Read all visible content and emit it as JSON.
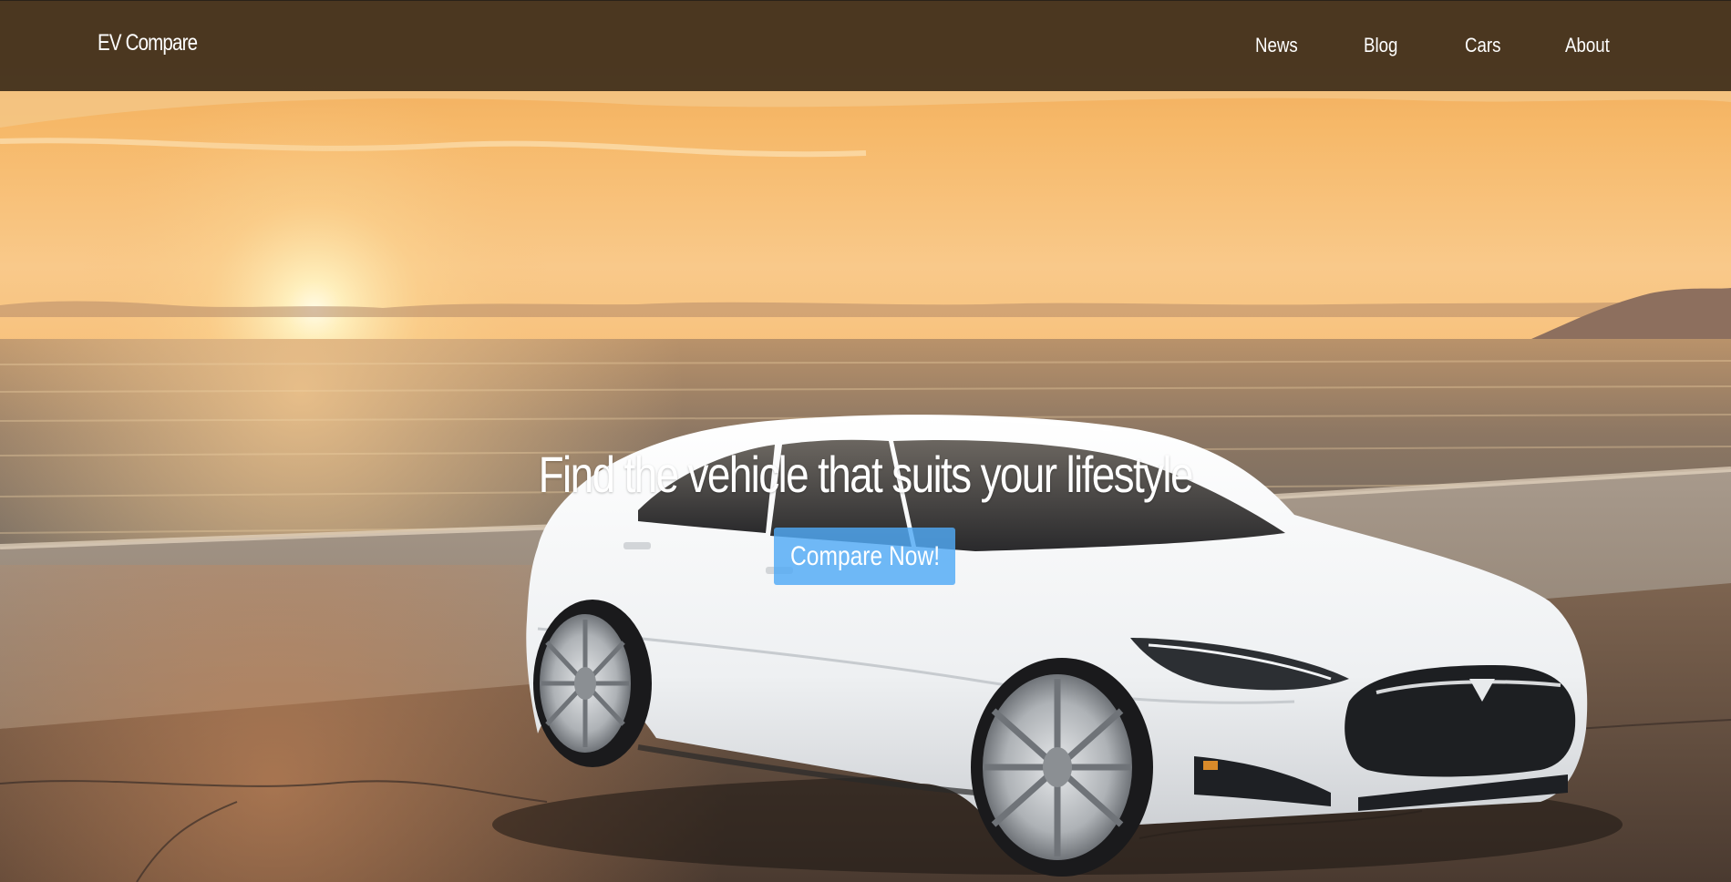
{
  "navbar": {
    "brand": "EV Compare",
    "links": [
      {
        "label": "News"
      },
      {
        "label": "Blog"
      },
      {
        "label": "Cars"
      },
      {
        "label": "About"
      }
    ]
  },
  "hero": {
    "headline": "Find the vehicle that suits your lifestyle",
    "cta_label": "Compare Now!",
    "background_image": "white electric sedan parked on a beach at sunset"
  },
  "colors": {
    "navbar_bg": "#3e2e1c",
    "cta_bg": "#50aaf5",
    "text": "#ffffff"
  }
}
